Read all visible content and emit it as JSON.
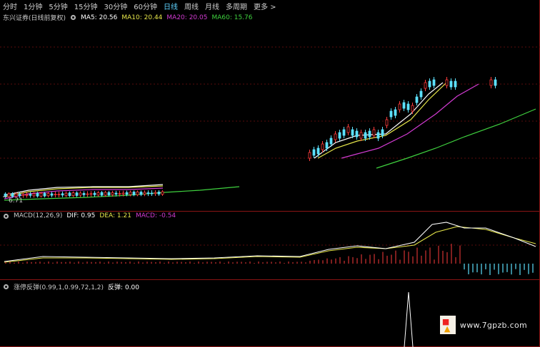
{
  "toolbar": {
    "periods": [
      "分时",
      "1分钟",
      "5分钟",
      "15分钟",
      "30分钟",
      "60分钟",
      "日线",
      "周线",
      "月线",
      "多周期"
    ],
    "active": "日线",
    "more_label": "更多 >"
  },
  "main_panel": {
    "title": "东兴证券(日线前复权)",
    "ma": [
      {
        "label": "MA5:",
        "value": "20.56",
        "color": "#ffffff"
      },
      {
        "label": "MA10:",
        "value": "20.44",
        "color": "#e6e64a"
      },
      {
        "label": "MA20:",
        "value": "20.05",
        "color": "#d23bd2"
      },
      {
        "label": "MA60:",
        "value": "15.76",
        "color": "#3fd23f"
      }
    ],
    "low_label": "6.71"
  },
  "macd_panel": {
    "title": "MACD(12,26,9)",
    "dif": {
      "label": "DIF:",
      "value": "0.95",
      "color": "#ffffff"
    },
    "dea": {
      "label": "DEA:",
      "value": "1.21",
      "color": "#e6e64a"
    },
    "macd": {
      "label": "MACD:",
      "value": "-0.54",
      "color": "#d23bd2"
    }
  },
  "signal_panel": {
    "title": "涨停反弹(0.99,1,0.99,72,1,2)",
    "item": {
      "label": "反弹:",
      "value": "0.00",
      "color": "#ffffff"
    }
  },
  "watermark": {
    "site": "www.7gpzb.com"
  },
  "colors": {
    "up": "#ff3c3c",
    "down": "#5ce1ff",
    "border": "#7a1010"
  }
}
